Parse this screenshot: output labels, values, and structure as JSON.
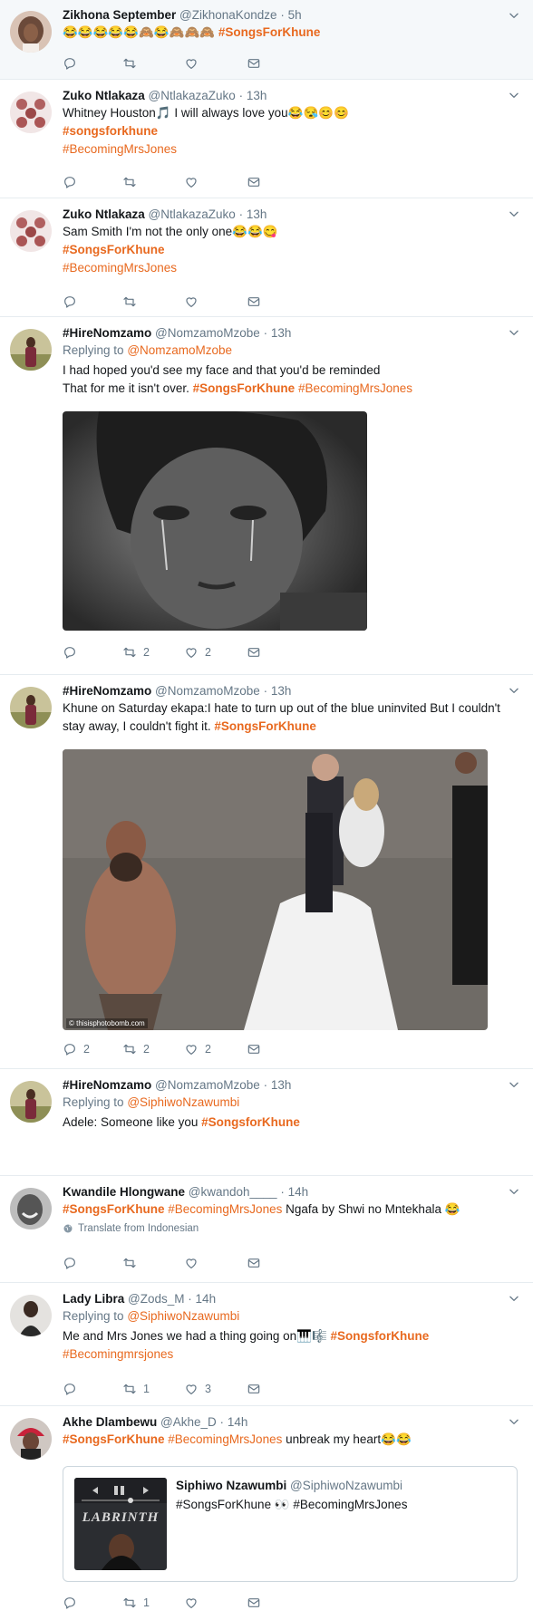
{
  "accent": "#e8691f",
  "tweets": [
    {
      "name": "Zikhona September",
      "handle": "@ZikhonaKondze",
      "time": "5h",
      "emoji": "😂😂😂😂😂🙈😂🙈🙈🙈",
      "hashtag": "#SongsForKhune"
    },
    {
      "name": "Zuko Ntlakaza",
      "handle": "@NtlakazaZuko",
      "time": "13h",
      "text1": "Whitney Houston🎵 I will always love you😂😪😊😊",
      "hashtag1": "#songsforkhune",
      "hashtag2": "#BecomingMrsJones"
    },
    {
      "name": "Zuko Ntlakaza",
      "handle": "@NtlakazaZuko",
      "time": "13h",
      "text1": "Sam Smith I'm not the only one😂😂😋",
      "hashtag1": "#SongsForKhune",
      "hashtag2": "#BecomingMrsJones"
    },
    {
      "name": "#HireNomzamo",
      "handle": "@NomzamoMzobe",
      "time": "13h",
      "replying": "Replying to",
      "reply_to": "@NomzamoMzobe",
      "text1": "I had hoped you'd see my face and that you'd be reminded",
      "text2": "That for me it isn't over.",
      "hashtag1": "#SongsForKhune",
      "hashtag2": "#BecomingMrsJones",
      "retweets": "2",
      "likes": "2"
    },
    {
      "name": "#HireNomzamo",
      "handle": "@NomzamoMzobe",
      "time": "13h",
      "text1": "Khune on Saturday ekapa:I hate to turn up out of the blue uninvited But I couldn't",
      "text2": "stay away, I couldn't fight it.",
      "hashtag1": "#SongsForKhune",
      "watermark": "© thisisphotobomb.com",
      "replies": "2",
      "retweets": "2",
      "likes": "2"
    },
    {
      "name": "#HireNomzamo",
      "handle": "@NomzamoMzobe",
      "time": "13h",
      "replying": "Replying to",
      "reply_to": "@SiphiwoNzawumbi",
      "text1": "Adele: Someone like you",
      "hashtag1": "#SongsforKhune"
    },
    {
      "name": "Kwandile Hlongwane",
      "handle": "@kwandoh____",
      "time": "14h",
      "hashtag1": "#SongsForKhune",
      "hashtag2": "#BecomingMrsJones",
      "text1": "Ngafa by Shwi no Mntekhala 😂",
      "translate": "Translate from Indonesian"
    },
    {
      "name": "Lady Libra",
      "handle": "@Zods_M",
      "time": "14h",
      "replying": "Replying to",
      "reply_to": "@SiphiwoNzawumbi",
      "text1": "Me and Mrs Jones we had a thing going on🎹🎼",
      "hashtag1": "#SongsforKhune",
      "hashtag2": "#Becomingmrsjones",
      "retweets": "1",
      "likes": "3"
    },
    {
      "name": "Akhe Dlambewu",
      "handle": "@Akhe_D",
      "time": "14h",
      "hashtag1": "#SongsForKhune",
      "hashtag2": "#BecomingMrsJones",
      "text1": "unbreak my heart😂😂",
      "quote_name": "Siphiwo Nzawumbi",
      "quote_handle": "@SiphiwoNzawumbi",
      "quote_text": "#SongsForKhune 👀 #BecomingMrsJones",
      "album_text": "LABRINTH",
      "retweets": "1"
    }
  ]
}
